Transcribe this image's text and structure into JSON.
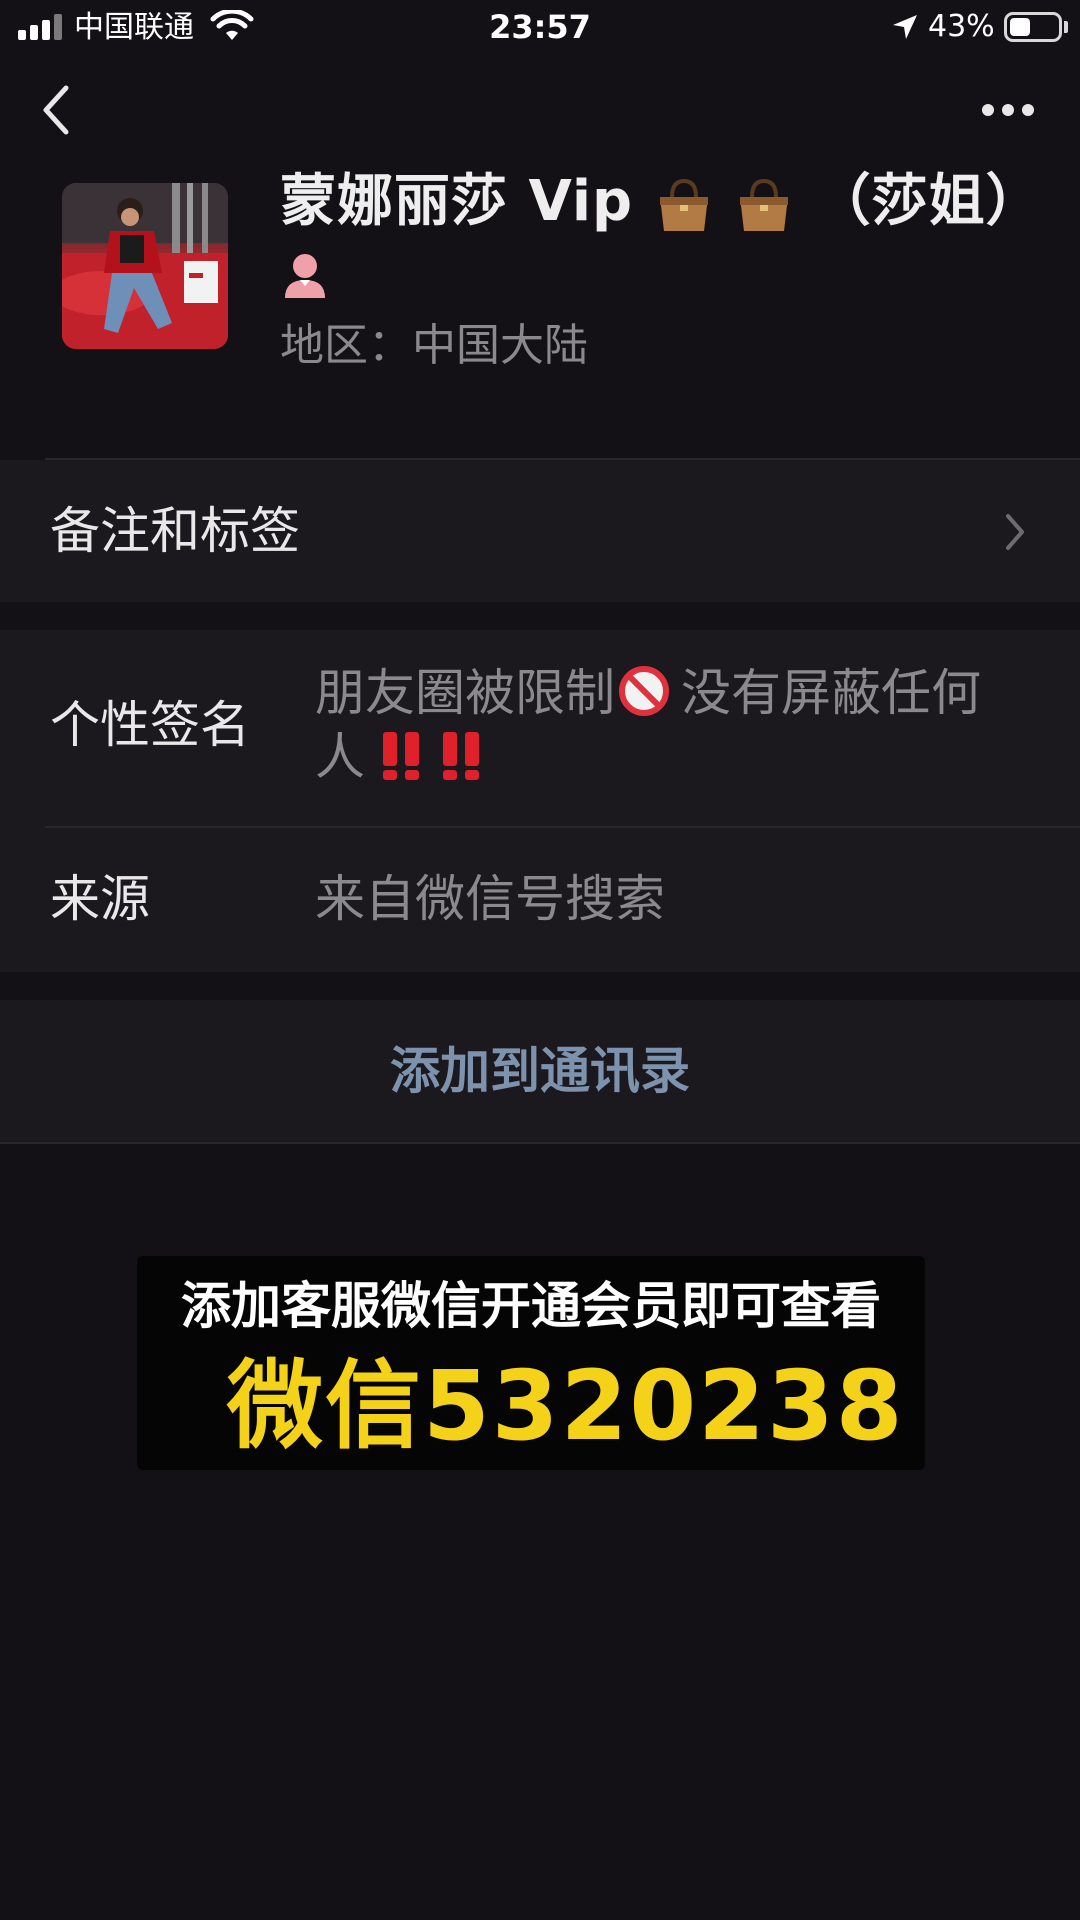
{
  "status_bar": {
    "carrier": "中国联通",
    "time": "23:57",
    "battery": "43%",
    "battery_level": 0.43,
    "icons": [
      "signal-icon",
      "wifi-icon",
      "location-arrow-icon",
      "battery-icon"
    ]
  },
  "nav": {
    "back_icon": "chevron-left-icon",
    "more_icon": "more-dots-icon"
  },
  "profile": {
    "name": "蒙娜丽莎 Vip",
    "name_suffix": "（莎姐）",
    "name_emojis": [
      "handbag-icon",
      "handbag-icon"
    ],
    "gender_icon": "female-icon",
    "region": "地区：中国大陆"
  },
  "remarks_row": {
    "label": "备注和标签",
    "icon": "chevron-right-icon"
  },
  "signature_row": {
    "label": "个性签名",
    "value_line1": "朋友圈被限制",
    "value_line1_after": "没有屏蔽任何",
    "value_line2": "人",
    "icons": [
      "prohibited-icon",
      "double-exclamation-icon",
      "double-exclamation-icon"
    ]
  },
  "source_row": {
    "label": "来源",
    "value": "来自微信号搜索"
  },
  "add_to_contacts": "添加到通讯录",
  "promo": {
    "line1": "添加客服微信开通会员即可查看",
    "line2": "微信5320238"
  },
  "colors": {
    "background": "#141116",
    "section": "#1b181e",
    "link": "#7d93ad",
    "promo_yellow": "#f5d21a"
  }
}
